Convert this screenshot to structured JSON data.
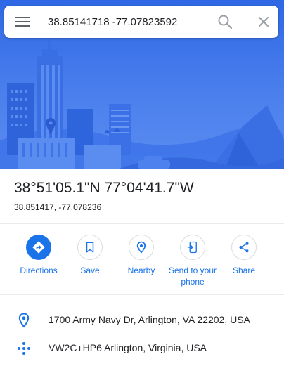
{
  "search": {
    "value": "38.85141718 -77.07823592"
  },
  "place": {
    "title": "38°51'05.1\"N 77°04'41.7\"W",
    "decimal": "38.851417, -77.078236"
  },
  "actions": [
    {
      "label": "Directions",
      "icon": "directions-icon"
    },
    {
      "label": "Save",
      "icon": "bookmark-icon"
    },
    {
      "label": "Nearby",
      "icon": "nearby-icon"
    },
    {
      "label": "Send to your phone",
      "icon": "send-to-phone-icon"
    },
    {
      "label": "Share",
      "icon": "share-icon"
    }
  ],
  "details": {
    "address": "1700 Army Navy Dr, Arlington, VA 22202, USA",
    "plus_code": "VW2C+HP6 Arlington, Virginia, USA"
  },
  "colors": {
    "accent": "#1a73e8",
    "hero_blue": "#2f68e5",
    "text": "#202124"
  }
}
